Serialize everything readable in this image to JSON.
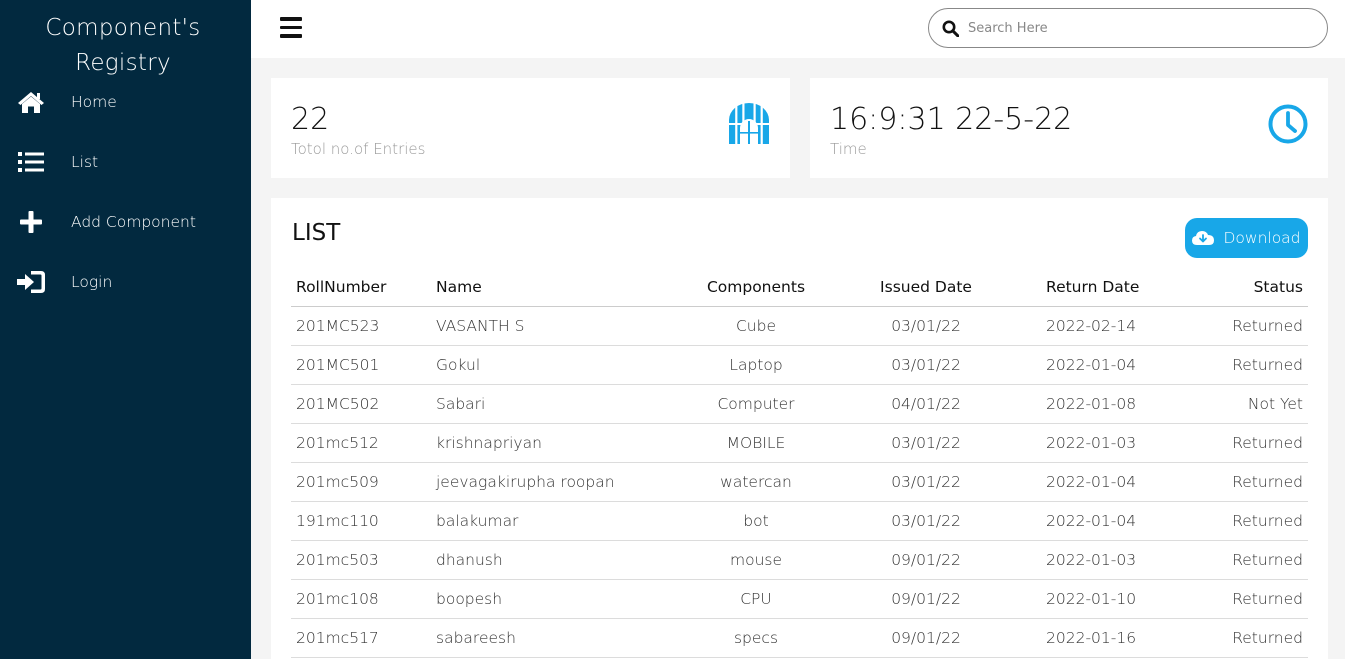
{
  "sidebar": {
    "brand_line1": "Component's",
    "brand_line2": "Registry",
    "items": [
      {
        "label": "Home",
        "icon": "home-icon"
      },
      {
        "label": "List",
        "icon": "list-icon"
      },
      {
        "label": "Add Component",
        "icon": "plus-icon"
      },
      {
        "label": "Login",
        "icon": "sign-in-icon"
      }
    ]
  },
  "topbar": {
    "search_placeholder": "Search Here"
  },
  "cards": {
    "entries": {
      "value": "22",
      "label": "Totol no.of Entries",
      "icon": "archway-icon"
    },
    "time": {
      "value": "16:9:31 22-5-22",
      "label": "Time",
      "icon": "clock-icon"
    }
  },
  "list": {
    "title": "LIST",
    "download_label": "Download",
    "columns": [
      "RollNumber",
      "Name",
      "Components",
      "Issued Date",
      "Return Date",
      "Status"
    ],
    "rows": [
      [
        "201MC523",
        "VASANTH S",
        "Cube",
        "03/01/22",
        "2022-02-14",
        "Returned"
      ],
      [
        "201MC501",
        "Gokul",
        "Laptop",
        "03/01/22",
        "2022-01-04",
        "Returned"
      ],
      [
        "201MC502",
        "Sabari",
        "Computer",
        "04/01/22",
        "2022-01-08",
        "Not Yet"
      ],
      [
        "201mc512",
        "krishnapriyan",
        "MOBILE",
        "03/01/22",
        "2022-01-03",
        "Returned"
      ],
      [
        "201mc509",
        "jeevagakirupha roopan",
        "watercan",
        "03/01/22",
        "2022-01-04",
        "Returned"
      ],
      [
        "191mc110",
        "balakumar",
        "bot",
        "03/01/22",
        "2022-01-04",
        "Returned"
      ],
      [
        "201mc503",
        "dhanush",
        "mouse",
        "09/01/22",
        "2022-01-03",
        "Returned"
      ],
      [
        "201mc108",
        "boopesh",
        "CPU",
        "09/01/22",
        "2022-01-10",
        "Returned"
      ],
      [
        "201mc517",
        "sabareesh",
        "specs",
        "09/01/22",
        "2022-01-16",
        "Returned"
      ]
    ]
  },
  "colors": {
    "sidebar_bg": "#02293f",
    "accent": "#18a7e8",
    "page_bg": "#f4f4f4"
  }
}
